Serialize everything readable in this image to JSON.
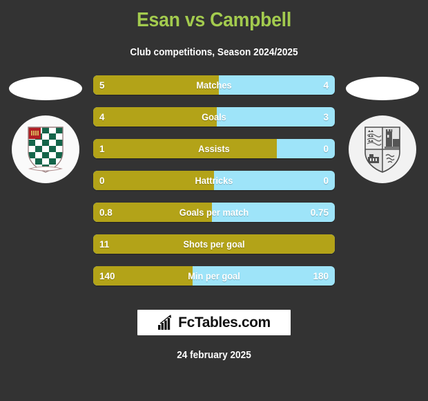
{
  "header": {
    "title": "Esan vs Campbell",
    "subtitle": "Club competitions, Season 2024/2025",
    "title_color": "#a3cb4e"
  },
  "colors": {
    "background": "#333333",
    "home_bar": "#b3a318",
    "away_bar": "#9ee4f9",
    "title_green": "#a3cb4e",
    "text_white": "#ffffff"
  },
  "left_player": {
    "photo": "player-photo-placeholder",
    "crest": "club-crest-green-checkerboard"
  },
  "right_player": {
    "photo": "player-photo-placeholder",
    "crest": "club-crest-grayscale-quartered"
  },
  "chart_data": {
    "type": "bar",
    "title": "Esan vs Campbell",
    "subtitle": "Club competitions, Season 2024/2025",
    "orientation": "horizontal-diverging",
    "categories": [
      "Matches",
      "Goals",
      "Assists",
      "Hattricks",
      "Goals per match",
      "Shots per goal",
      "Min per goal"
    ],
    "series": [
      {
        "name": "Esan",
        "side": "left",
        "color": "#b3a318",
        "values": [
          "5",
          "4",
          "1",
          "0",
          "0.8",
          "11",
          "140"
        ]
      },
      {
        "name": "Campbell",
        "side": "right",
        "color": "#9ee4f9",
        "values": [
          "4",
          "3",
          "0",
          "0",
          "0.75",
          "",
          "180"
        ]
      }
    ],
    "left_share_percent": [
      52,
      51,
      76,
      50,
      49,
      100,
      41
    ],
    "xlabel": "",
    "ylabel": "",
    "grid": false,
    "legend": "none"
  },
  "rows": [
    {
      "label": "Matches",
      "left": "5",
      "right": "4",
      "left_pct": 52,
      "right_visible": true
    },
    {
      "label": "Goals",
      "left": "4",
      "right": "3",
      "left_pct": 51,
      "right_visible": true
    },
    {
      "label": "Assists",
      "left": "1",
      "right": "0",
      "left_pct": 76,
      "right_visible": true
    },
    {
      "label": "Hattricks",
      "left": "0",
      "right": "0",
      "left_pct": 50,
      "right_visible": true
    },
    {
      "label": "Goals per match",
      "left": "0.8",
      "right": "0.75",
      "left_pct": 49,
      "right_visible": true
    },
    {
      "label": "Shots per goal",
      "left": "11",
      "right": "",
      "left_pct": 100,
      "right_visible": false
    },
    {
      "label": "Min per goal",
      "left": "140",
      "right": "180",
      "left_pct": 41,
      "right_visible": true
    }
  ],
  "footer": {
    "logo_text": "FcTables.com",
    "logo_icon": "bar-chart-arrow-icon",
    "date": "24 february 2025"
  }
}
